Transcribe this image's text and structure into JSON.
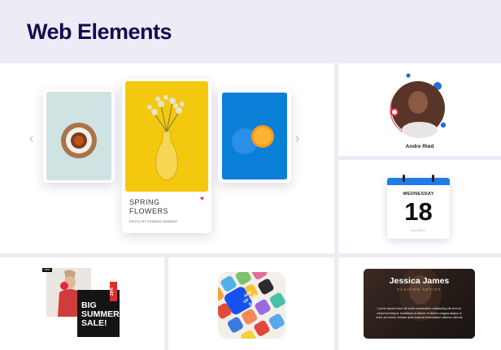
{
  "header": {
    "title": "Web Elements"
  },
  "slider": {
    "prev_arrow": "‹",
    "next_arrow": "›",
    "main_card": {
      "title_line1": "SPRING",
      "title_line2": "FLOWERS",
      "subtitle": "PHOTO BY EDWARD IBANDER",
      "like_icon": "♥"
    }
  },
  "profile": {
    "name": "Andre Ried"
  },
  "calendar": {
    "day_name": "WEDNESDAY",
    "date": "18",
    "month": "AUGUST"
  },
  "sale": {
    "tag": "20%",
    "line1": "BIG",
    "line2": "SUMMER",
    "line3": "SALE!",
    "small_label": "NEW"
  },
  "app_of_day": {
    "line1": "APP",
    "line2": "OF THE",
    "line3": "DAY"
  },
  "artist": {
    "name": "Jessica James",
    "role": "FASHION ARTIST",
    "bio": "Lorem ipsum dolor sit amet consectetur adipiscing elit sed do eiusmod tempor incididunt ut labore et dolore magna aliqua ut enim ad minim veniam quis nostrud exercitation ullamco laboris"
  },
  "colors": {
    "title": "#150b4d",
    "accent_blue": "#1f7de6",
    "heart_red": "#e0293a",
    "flower_yellow": "#f4c80e",
    "orange_blue": "#0a7fd8"
  }
}
